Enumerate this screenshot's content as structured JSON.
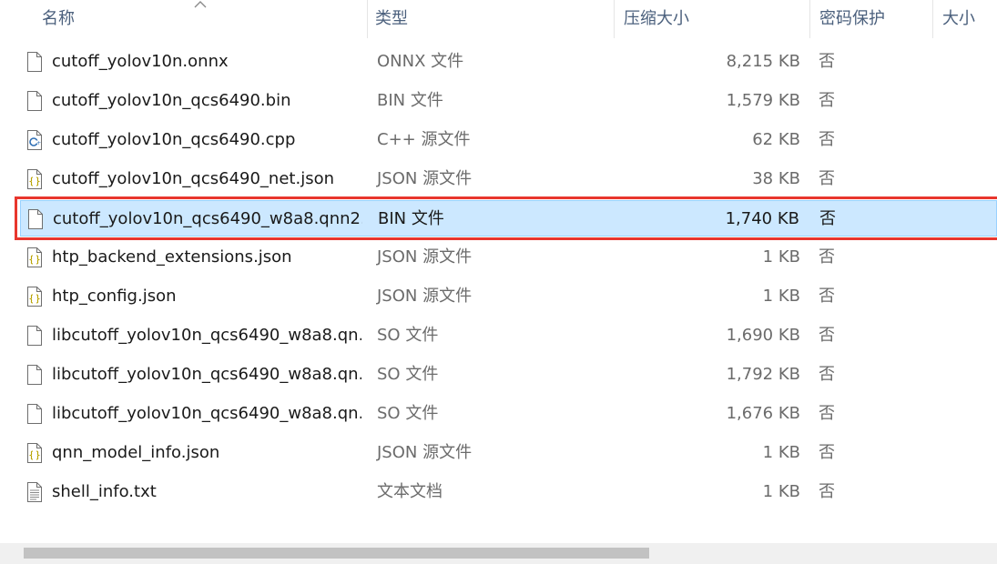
{
  "columns": {
    "name": "名称",
    "type": "类型",
    "compressed_size": "压缩大小",
    "password": "密码保护",
    "size": "大小"
  },
  "files": [
    {
      "name": "cutoff_yolov10n.onnx",
      "type": "ONNX 文件",
      "size": "8,215 KB",
      "password": "否",
      "icon": "file-icon",
      "selected": false
    },
    {
      "name": "cutoff_yolov10n_qcs6490.bin",
      "type": "BIN 文件",
      "size": "1,579 KB",
      "password": "否",
      "icon": "file-icon",
      "selected": false
    },
    {
      "name": "cutoff_yolov10n_qcs6490.cpp",
      "type": "C++ 源文件",
      "size": "62 KB",
      "password": "否",
      "icon": "cpp-file-icon",
      "selected": false
    },
    {
      "name": "cutoff_yolov10n_qcs6490_net.json",
      "type": "JSON 源文件",
      "size": "38 KB",
      "password": "否",
      "icon": "json-file-icon",
      "selected": false
    },
    {
      "name": "cutoff_yolov10n_qcs6490_w8a8.qnn2...",
      "type": "BIN 文件",
      "size": "1,740 KB",
      "password": "否",
      "icon": "file-icon",
      "selected": true
    },
    {
      "name": "htp_backend_extensions.json",
      "type": "JSON 源文件",
      "size": "1 KB",
      "password": "否",
      "icon": "json-file-icon",
      "selected": false
    },
    {
      "name": "htp_config.json",
      "type": "JSON 源文件",
      "size": "1 KB",
      "password": "否",
      "icon": "json-file-icon",
      "selected": false
    },
    {
      "name": "libcutoff_yolov10n_qcs6490_w8a8.qn...",
      "type": "SO 文件",
      "size": "1,690 KB",
      "password": "否",
      "icon": "file-icon",
      "selected": false
    },
    {
      "name": "libcutoff_yolov10n_qcs6490_w8a8.qn...",
      "type": "SO 文件",
      "size": "1,792 KB",
      "password": "否",
      "icon": "file-icon",
      "selected": false
    },
    {
      "name": "libcutoff_yolov10n_qcs6490_w8a8.qn...",
      "type": "SO 文件",
      "size": "1,676 KB",
      "password": "否",
      "icon": "file-icon",
      "selected": false
    },
    {
      "name": "qnn_model_info.json",
      "type": "JSON 源文件",
      "size": "1 KB",
      "password": "否",
      "icon": "json-file-icon",
      "selected": false
    },
    {
      "name": "shell_info.txt",
      "type": "文本文档",
      "size": "1 KB",
      "password": "否",
      "icon": "text-file-icon",
      "selected": false
    }
  ],
  "colors": {
    "selection_bg": "#cce8ff",
    "selection_border": "#99d1ff",
    "highlight_outline": "#e8362d",
    "header_text": "#4a5f7c"
  }
}
